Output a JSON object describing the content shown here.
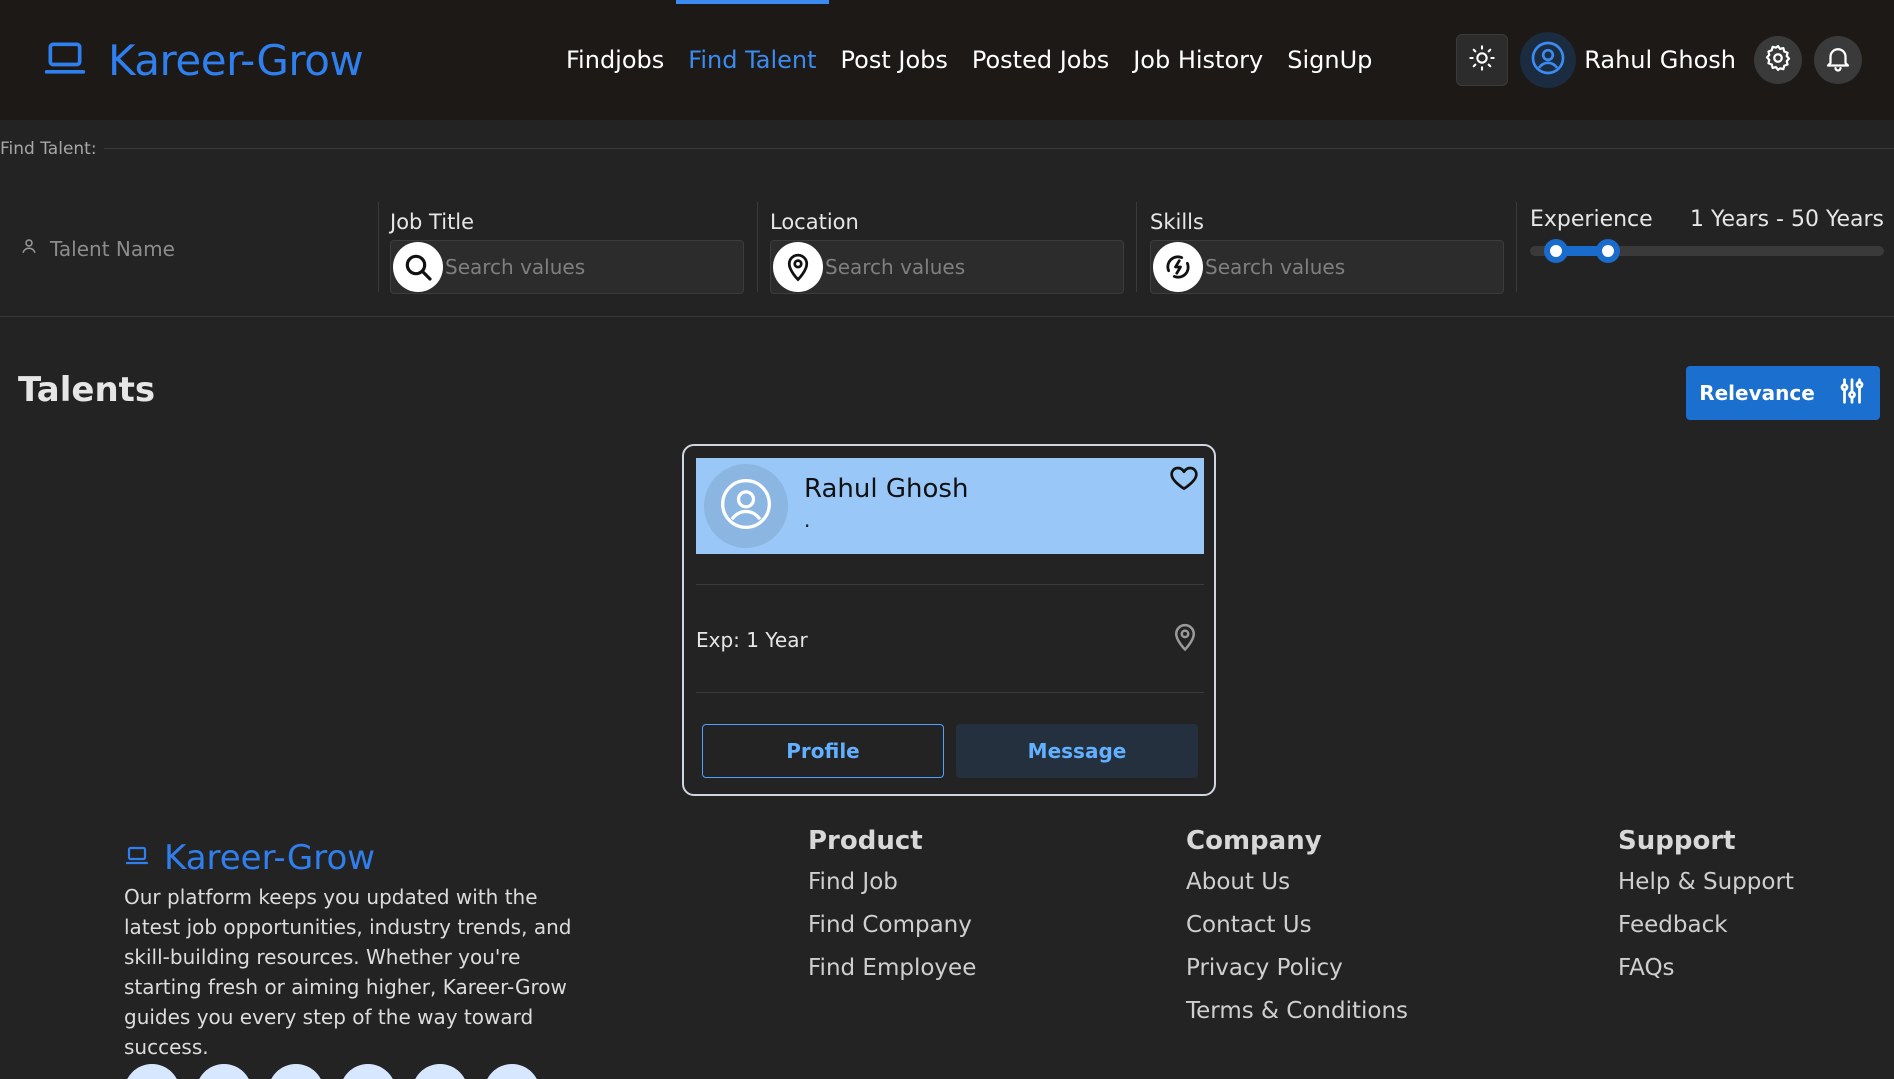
{
  "brand": {
    "name": "Kareer-Grow"
  },
  "nav": {
    "items": [
      "Findjobs",
      "Find Talent",
      "Post Jobs",
      "Posted Jobs",
      "Job History",
      "SignUp"
    ],
    "active": "Find Talent"
  },
  "header": {
    "user_name": "Rahul Ghosh",
    "icons": [
      "sun-icon",
      "user-circle-icon",
      "gear-icon",
      "bell-icon"
    ]
  },
  "filters": {
    "legend": "Find Talent:",
    "talent_name_placeholder": "Talent Name",
    "job_title": {
      "label": "Job Title",
      "placeholder": "Search values"
    },
    "location": {
      "label": "Location",
      "placeholder": "Search values"
    },
    "skills": {
      "label": "Skills",
      "placeholder": "Search values"
    },
    "experience": {
      "label": "Experience",
      "range_text": "1 Years - 50 Years",
      "min": 1,
      "max": 50
    }
  },
  "talents": {
    "title": "Talents",
    "sort_label": "Relevance",
    "card": {
      "name": "Rahul Ghosh",
      "subtitle": ".",
      "experience": "Exp: 1 Year",
      "profile_label": "Profile",
      "message_label": "Message"
    }
  },
  "footer": {
    "brand": "Kareer-Grow",
    "description": "Our platform keeps you updated with the latest job opportunities, industry trends, and skill-building resources. Whether you're starting fresh or aiming higher, Kareer-Grow guides you every step of the way toward success.",
    "columns": [
      {
        "title": "Product",
        "links": [
          "Find Job",
          "Find Company",
          "Find Employee"
        ]
      },
      {
        "title": "Company",
        "links": [
          "About Us",
          "Contact Us",
          "Privacy Policy",
          "Terms & Conditions"
        ]
      },
      {
        "title": "Support",
        "links": [
          "Help & Support",
          "Feedback",
          "FAQs"
        ]
      }
    ]
  },
  "colors": {
    "accent": "#2f7fee",
    "primary_button": "#1b6fcf",
    "card_header": "#99c7f8",
    "background": "#232323",
    "header_bg": "#1c1917"
  }
}
